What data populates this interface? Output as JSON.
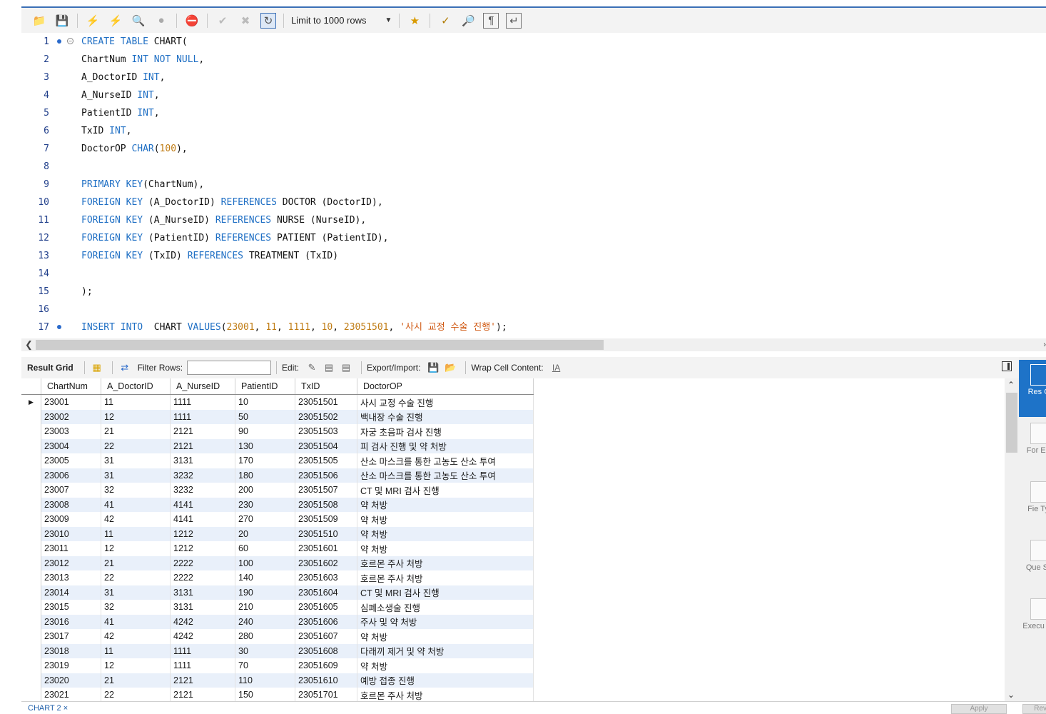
{
  "toolbar": {
    "limit_label": "Limit to 1000 rows",
    "icons": [
      "open-folder-icon",
      "save-icon",
      "execute-icon",
      "execute-current-icon",
      "explain-icon",
      "stop-icon",
      "toggle-error-icon",
      "commit-icon",
      "rollback-icon",
      "autocommit-icon",
      "bookmark-icon",
      "beautify-icon",
      "find-icon",
      "invisible-chars-icon",
      "wrap-icon"
    ]
  },
  "editor": {
    "lines": [
      {
        "n": "1",
        "tokens": [
          [
            "kw",
            "CREATE TABLE"
          ],
          [
            "id",
            " CHART("
          ]
        ]
      },
      {
        "n": "2",
        "tokens": [
          [
            "id",
            "ChartNum "
          ],
          [
            "kw",
            "INT NOT NULL"
          ],
          [
            "id",
            ","
          ]
        ]
      },
      {
        "n": "3",
        "tokens": [
          [
            "id",
            "A_DoctorID "
          ],
          [
            "kw",
            "INT"
          ],
          [
            "id",
            ","
          ]
        ]
      },
      {
        "n": "4",
        "tokens": [
          [
            "id",
            "A_NurseID "
          ],
          [
            "kw",
            "INT"
          ],
          [
            "id",
            ","
          ]
        ]
      },
      {
        "n": "5",
        "tokens": [
          [
            "id",
            "PatientID "
          ],
          [
            "kw",
            "INT"
          ],
          [
            "id",
            ","
          ]
        ]
      },
      {
        "n": "6",
        "tokens": [
          [
            "id",
            "TxID "
          ],
          [
            "kw",
            "INT"
          ],
          [
            "id",
            ","
          ]
        ]
      },
      {
        "n": "7",
        "tokens": [
          [
            "id",
            "DoctorOP "
          ],
          [
            "kw",
            "CHAR"
          ],
          [
            "id",
            "("
          ],
          [
            "num",
            "100"
          ],
          [
            "id",
            "),"
          ]
        ]
      },
      {
        "n": "8",
        "tokens": []
      },
      {
        "n": "9",
        "tokens": [
          [
            "kw",
            "PRIMARY KEY"
          ],
          [
            "id",
            "(ChartNum),"
          ]
        ]
      },
      {
        "n": "10",
        "tokens": [
          [
            "kw",
            "FOREIGN KEY"
          ],
          [
            "id",
            " (A_DoctorID) "
          ],
          [
            "kw",
            "REFERENCES"
          ],
          [
            "id",
            " DOCTOR (DoctorID),"
          ]
        ]
      },
      {
        "n": "11",
        "tokens": [
          [
            "kw",
            "FOREIGN KEY"
          ],
          [
            "id",
            " (A_NurseID) "
          ],
          [
            "kw",
            "REFERENCES"
          ],
          [
            "id",
            " NURSE (NurseID),"
          ]
        ]
      },
      {
        "n": "12",
        "tokens": [
          [
            "kw",
            "FOREIGN KEY"
          ],
          [
            "id",
            " (PatientID) "
          ],
          [
            "kw",
            "REFERENCES"
          ],
          [
            "id",
            " PATIENT (PatientID),"
          ]
        ]
      },
      {
        "n": "13",
        "tokens": [
          [
            "kw",
            "FOREIGN KEY"
          ],
          [
            "id",
            " (TxID) "
          ],
          [
            "kw",
            "REFERENCES"
          ],
          [
            "id",
            " TREATMENT (TxID)"
          ]
        ]
      },
      {
        "n": "14",
        "tokens": []
      },
      {
        "n": "15",
        "tokens": [
          [
            "id",
            ");"
          ]
        ]
      },
      {
        "n": "16",
        "tokens": []
      },
      {
        "n": "17",
        "tokens": [
          [
            "kw",
            "INSERT INTO"
          ],
          [
            "id",
            "  CHART "
          ],
          [
            "kw",
            "VALUES"
          ],
          [
            "id",
            "("
          ],
          [
            "num",
            "23001"
          ],
          [
            "id",
            ", "
          ],
          [
            "num",
            "11"
          ],
          [
            "id",
            ", "
          ],
          [
            "num",
            "1111"
          ],
          [
            "id",
            ", "
          ],
          [
            "num",
            "10"
          ],
          [
            "id",
            ", "
          ],
          [
            "num",
            "23051501"
          ],
          [
            "id",
            ", "
          ],
          [
            "str",
            "'사시 교정 수술 진행'"
          ],
          [
            "id",
            ");"
          ]
        ]
      }
    ],
    "dots": [
      "1",
      "17"
    ]
  },
  "result_toolbar": {
    "result_grid_label": "Result Grid",
    "filter_label": "Filter Rows:",
    "filter_value": "",
    "edit_label": "Edit:",
    "export_label": "Export/Import:",
    "wrap_label": "Wrap Cell Content:"
  },
  "grid": {
    "columns": [
      "ChartNum",
      "A_DoctorID",
      "A_NurseID",
      "PatientID",
      "TxID",
      "DoctorOP"
    ],
    "rows": [
      [
        "23001",
        "11",
        "1111",
        "10",
        "23051501",
        "사시 교정 수술 진행"
      ],
      [
        "23002",
        "12",
        "1111",
        "50",
        "23051502",
        "백내장 수술 진행"
      ],
      [
        "23003",
        "21",
        "2121",
        "90",
        "23051503",
        "자궁 초음파 검사 진행"
      ],
      [
        "23004",
        "22",
        "2121",
        "130",
        "23051504",
        "피 검사 진행 및 약 처방"
      ],
      [
        "23005",
        "31",
        "3131",
        "170",
        "23051505",
        "산소 마스크를 통한 고농도 산소 투여"
      ],
      [
        "23006",
        "31",
        "3232",
        "180",
        "23051506",
        "산소 마스크를 통한 고농도 산소 투여"
      ],
      [
        "23007",
        "32",
        "3232",
        "200",
        "23051507",
        "CT 및 MRI 검사 진행"
      ],
      [
        "23008",
        "41",
        "4141",
        "230",
        "23051508",
        "약 처방"
      ],
      [
        "23009",
        "42",
        "4141",
        "270",
        "23051509",
        "약 처방"
      ],
      [
        "23010",
        "11",
        "1212",
        "20",
        "23051510",
        "약 처방"
      ],
      [
        "23011",
        "12",
        "1212",
        "60",
        "23051601",
        "약 처방"
      ],
      [
        "23012",
        "21",
        "2222",
        "100",
        "23051602",
        "호르몬 주사 처방"
      ],
      [
        "23013",
        "22",
        "2222",
        "140",
        "23051603",
        "호르몬 주사 처방"
      ],
      [
        "23014",
        "31",
        "3131",
        "190",
        "23051604",
        "CT 및 MRI 검사 진행"
      ],
      [
        "23015",
        "32",
        "3131",
        "210",
        "23051605",
        "심폐소생술 진행"
      ],
      [
        "23016",
        "41",
        "4242",
        "240",
        "23051606",
        "주사 및 약 처방"
      ],
      [
        "23017",
        "42",
        "4242",
        "280",
        "23051607",
        "약 처방"
      ],
      [
        "23018",
        "11",
        "1111",
        "30",
        "23051608",
        "다래끼 제거 및 약 처방"
      ],
      [
        "23019",
        "12",
        "1111",
        "70",
        "23051609",
        "약 처방"
      ],
      [
        "23020",
        "21",
        "2121",
        "110",
        "23051610",
        "예방 접종 진행"
      ],
      [
        "23021",
        "22",
        "2121",
        "150",
        "23051701",
        "호르몬 주사 처방"
      ]
    ]
  },
  "side_panel": {
    "items": [
      "Res Gr",
      "For Edit",
      "Fie Typ",
      "Que Sta",
      "Execu Pla"
    ]
  },
  "bottom": {
    "tab_label": "CHART 2 ×",
    "apply_label": "Apply",
    "revert_label": "Revert"
  },
  "colors": {
    "keyword": "#1f6fc4",
    "number": "#c07c14",
    "string": "#d05a14",
    "selected_panel": "#1e73c8",
    "alt_row": "#e9f0fa"
  }
}
